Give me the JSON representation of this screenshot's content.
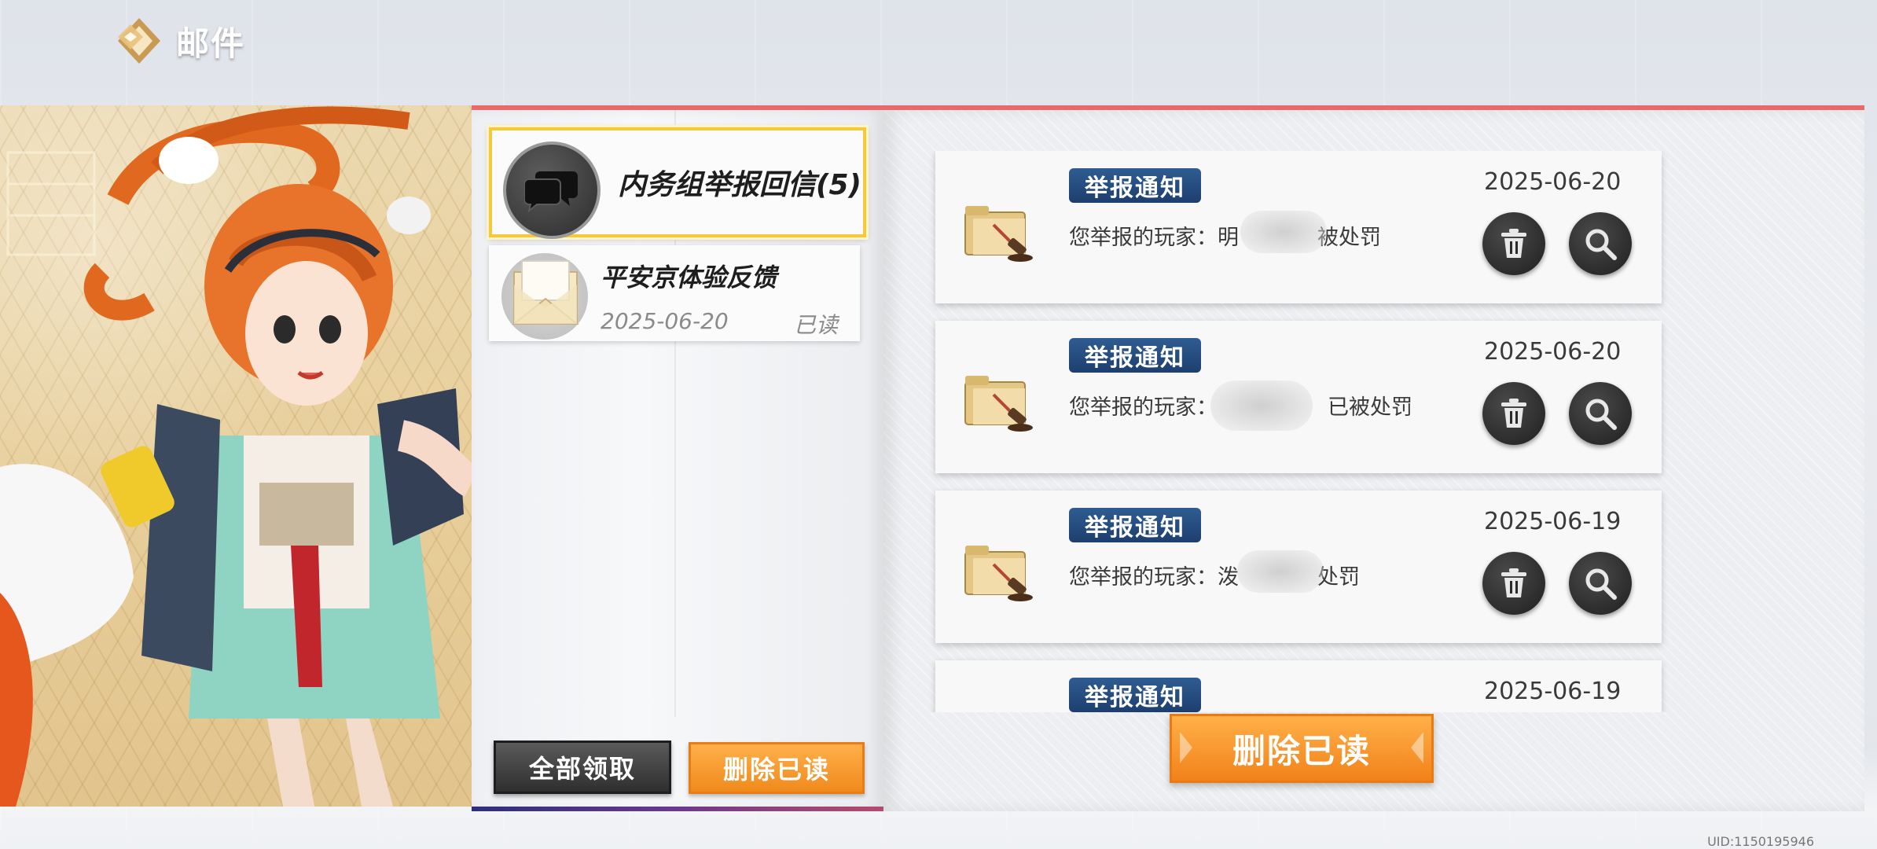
{
  "header": {
    "title": "邮件",
    "icon": "diamond-logo-icon"
  },
  "mail_list": {
    "items": [
      {
        "title": "内务组举报回信(5)",
        "icon": "chat-bubbles-icon",
        "selected": true
      },
      {
        "title": "平安京体验反馈",
        "date": "2025-06-20",
        "status": "已读",
        "icon": "envelope-icon"
      }
    ],
    "claim_all_label": "全部领取",
    "delete_read_label": "删除已读"
  },
  "notices": [
    {
      "tag": "举报通知",
      "date": "2025-06-20",
      "text_before": "您举报的玩家：明",
      "text_after": "被处罚"
    },
    {
      "tag": "举报通知",
      "date": "2025-06-20",
      "text_before": "您举报的玩家：",
      "text_after": "已被处罚"
    },
    {
      "tag": "举报通知",
      "date": "2025-06-19",
      "text_before": "您举报的玩家：泼",
      "text_after": "处罚"
    },
    {
      "tag": "举报通知",
      "date": "2025-06-19",
      "text_before": "",
      "text_after": ""
    }
  ],
  "detail": {
    "delete_read_label": "删除已读"
  },
  "footer": {
    "uid": "UID:1150195946"
  },
  "colors": {
    "accent_orange": "#f2821a",
    "tag_blue": "#1d3f6e",
    "selected_gold": "#f4c93d",
    "top_border": "#e86a6a"
  }
}
